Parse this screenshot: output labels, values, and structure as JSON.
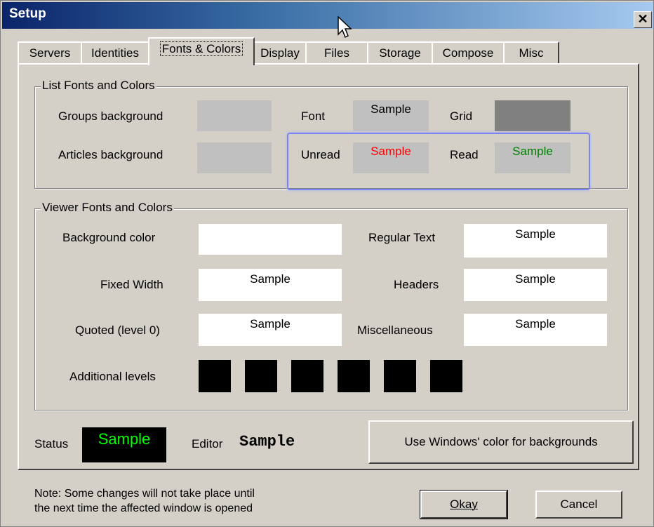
{
  "window": {
    "title": "Setup",
    "close_glyph": "✕"
  },
  "tabs": [
    "Servers",
    "Identities",
    "Fonts & Colors",
    "Display",
    "Files",
    "Storage",
    "Compose",
    "Misc"
  ],
  "active_tab": "Fonts & Colors",
  "list_group": {
    "title": "List Fonts and Colors",
    "groups_background": "Groups background",
    "articles_background": "Articles background",
    "font_label": "Font",
    "font_sample": "Sample",
    "grid_label": "Grid",
    "unread_label": "Unread",
    "unread_sample": "Sample",
    "read_label": "Read",
    "read_sample": "Sample"
  },
  "viewer_group": {
    "title": "Viewer Fonts and Colors",
    "background_color": "Background color",
    "regular_text": "Regular Text",
    "regular_sample": "Sample",
    "fixed_width": "Fixed Width",
    "fixed_sample": "Sample",
    "headers": "Headers",
    "headers_sample": "Sample",
    "quoted": "Quoted (level 0)",
    "quoted_sample": "Sample",
    "misc": "Miscellaneous",
    "misc_sample": "Sample",
    "additional_levels": "Additional levels"
  },
  "status_label": "Status",
  "status_sample": "Sample",
  "editor_label": "Editor",
  "editor_sample": "Sample",
  "windows_colors_button": "Use Windows' color for backgrounds",
  "note_line1": "Note: Some changes will not take place until",
  "note_line2": "the next time the affected window is opened",
  "okay_button": "Okay",
  "cancel_button": "Cancel",
  "colors": {
    "swatch_gray": "#c0c0c0",
    "grid_gray": "#808080",
    "unread": "#ff0000",
    "read": "#008000",
    "status_fg": "#00ff00",
    "status_bg": "#000000"
  }
}
